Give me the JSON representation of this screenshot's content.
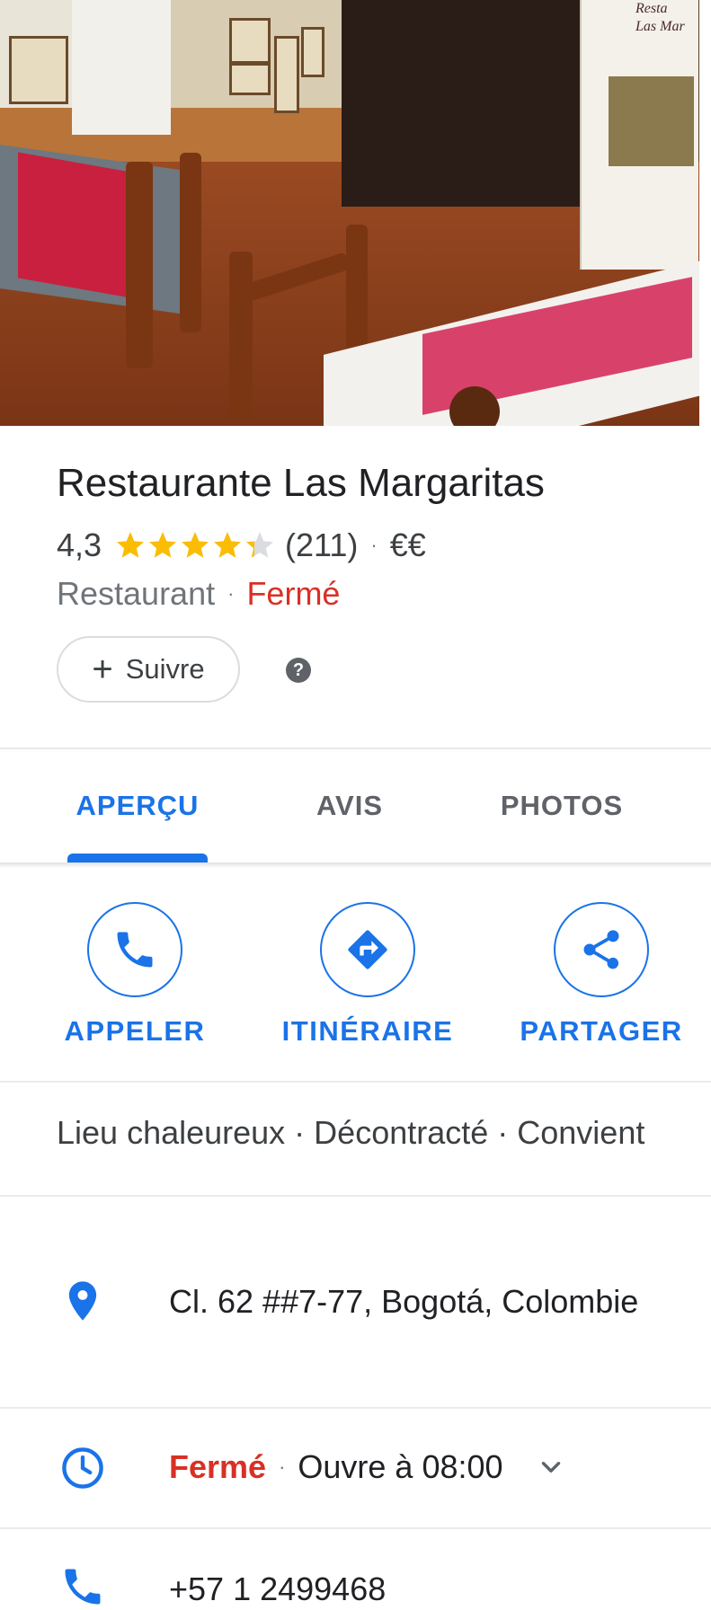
{
  "place": {
    "name": "Restaurante Las Margaritas",
    "rating": "4,3",
    "rating_value": 4.3,
    "reviews_count": "(211)",
    "price_level": "€€",
    "category": "Restaurant",
    "status": "Fermé",
    "separator": "·"
  },
  "hero": {
    "banner_text": "Resta\nLas Mar"
  },
  "follow": {
    "label": "Suivre",
    "plus": "+"
  },
  "help": {
    "glyph": "?"
  },
  "tabs": [
    {
      "label": "APERÇU",
      "active": true
    },
    {
      "label": "AVIS",
      "active": false
    },
    {
      "label": "PHOTOS",
      "active": false
    }
  ],
  "actions": [
    {
      "label": "APPELER",
      "icon": "phone-icon"
    },
    {
      "label": "ITINÉRAIRE",
      "icon": "directions-icon"
    },
    {
      "label": "PARTAGER",
      "icon": "share-icon"
    }
  ],
  "tags": "Lieu chaleureux · Décontracté · Convient",
  "address": {
    "text": "Cl. 62 ##7-77, Bogotá, Colombie",
    "icon": "location-pin-icon"
  },
  "hours": {
    "status": "Fermé",
    "separator": "·",
    "next": "Ouvre à 08:00",
    "icon": "clock-icon"
  },
  "phone": {
    "number": "+57 1 2499468",
    "icon": "phone-icon"
  },
  "colors": {
    "accent": "#1a73e8",
    "closed": "#d93025",
    "star": "#fbbc04",
    "star_empty": "#dadce0",
    "text_secondary": "#70757a"
  }
}
